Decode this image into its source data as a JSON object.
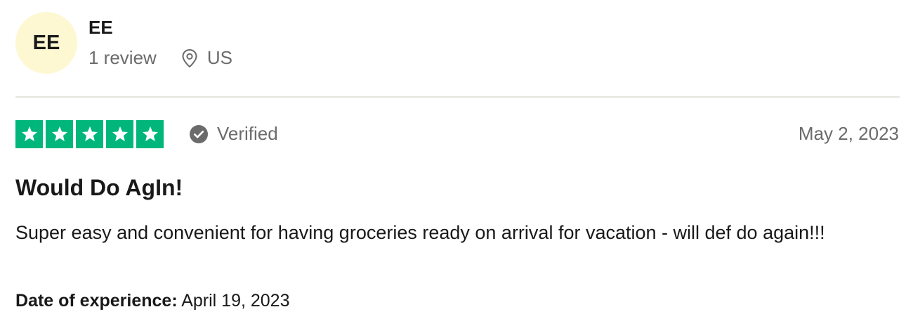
{
  "consumer": {
    "initials": "EE",
    "name": "EE",
    "review_count": "1 review",
    "location": "US",
    "avatar_color": "#fdf8d2"
  },
  "review": {
    "rating": 5,
    "max_rating": 5,
    "star_color": "#00b67a",
    "verified_label": "Verified",
    "date": "May 2, 2023",
    "title": "Would Do AgIn!",
    "body": "Super easy and convenient for having groceries ready on arrival for vacation - will def do again!!!",
    "experience_label": "Date of experience:",
    "experience_date": "April 19, 2023"
  },
  "icons": {
    "location": "map-pin-icon",
    "verified": "check-circle-icon",
    "star": "star-icon"
  }
}
